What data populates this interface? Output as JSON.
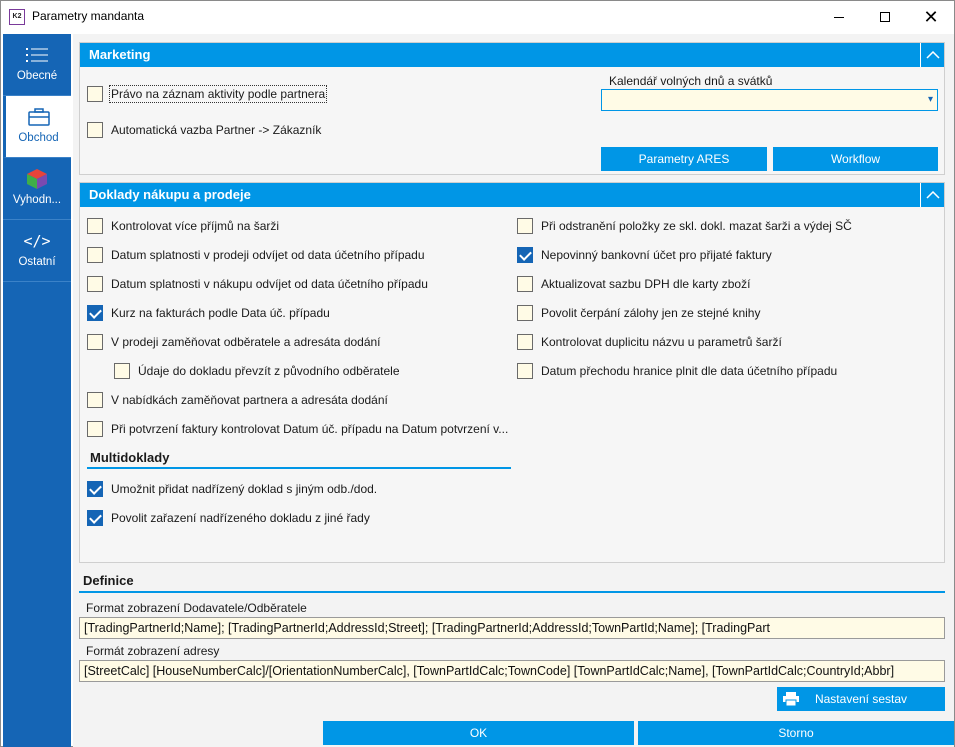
{
  "window": {
    "title": "Parametry mandanta",
    "app_icon": "K2"
  },
  "sidebar": {
    "items": [
      {
        "label": "Obecné",
        "icon": "list-icon"
      },
      {
        "label": "Obchod",
        "icon": "briefcase-icon"
      },
      {
        "label": "Vyhodn...",
        "icon": "cube-icon"
      },
      {
        "label": "Ostatní",
        "icon": "code-icon"
      }
    ],
    "active": "Obchod"
  },
  "marketing": {
    "title": "Marketing",
    "checkboxes": [
      {
        "label": "Právo na záznam aktivity podle partnera",
        "checked": false
      },
      {
        "label": "Automatická vazba Partner -> Zákazník",
        "checked": false
      }
    ],
    "calendar_label": "Kalendář volných dnů a svátků",
    "calendar_value": "",
    "ares_button": "Parametry ARES",
    "workflow_button": "Workflow"
  },
  "doklady": {
    "title": "Doklady nákupu a prodeje",
    "left": [
      {
        "label": "Kontrolovat více příjmů na šarži",
        "checked": false
      },
      {
        "label": "Datum splatnosti v prodeji odvíjet od data účetního případu",
        "checked": false
      },
      {
        "label": "Datum splatnosti v nákupu odvíjet od data účetního případu",
        "checked": false
      },
      {
        "label": "Kurz na fakturách podle Data úč. případu",
        "checked": true
      },
      {
        "label": "V prodeji zaměňovat odběratele a adresáta dodání",
        "checked": false
      },
      {
        "label": "Údaje do dokladu převzít z původního odběratele",
        "checked": false
      },
      {
        "label": "V nabídkách zaměňovat partnera a adresáta dodání",
        "checked": false
      },
      {
        "label": "Při potvrzení faktury kontrolovat Datum úč. případu na Datum potvrzení v...",
        "checked": false
      }
    ],
    "right": [
      {
        "label": "Při odstranění položky ze skl. dokl. mazat šarži a výdej SČ",
        "checked": false
      },
      {
        "label": "Nepovinný bankovní účet pro přijaté faktury",
        "checked": true
      },
      {
        "label": "Aktualizovat sazbu DPH dle karty zboží",
        "checked": false
      },
      {
        "label": "Povolit čerpání zálohy jen ze stejné knihy",
        "checked": false
      },
      {
        "label": "Kontrolovat duplicitu názvu u parametrů šarží",
        "checked": false
      },
      {
        "label": "Datum přechodu hranice plnit dle data účetního případu",
        "checked": false
      }
    ],
    "multidoklady": {
      "title": "Multidoklady",
      "items": [
        {
          "label": "Umožnit přidat nadřízený doklad s jiným odb./dod.",
          "checked": true
        },
        {
          "label": "Povolit zařazení nadřízeného dokladu z jiné řady",
          "checked": true
        }
      ]
    }
  },
  "definice": {
    "title": "Definice",
    "supplier_label": "Format zobrazení Dodavatele/Odběratele",
    "supplier_value": "[TradingPartnerId;Name]; [TradingPartnerId;AddressId;Street]; [TradingPartnerId;AddressId;TownPartId;Name]; [TradingPart",
    "address_label": "Formát zobrazení adresy",
    "address_value": "[StreetCalc] [HouseNumberCalc]/[OrientationNumberCalc], [TownPartIdCalc;TownCode]  [TownPartIdCalc;Name], [TownPartIdCalc;CountryId;Abbr]",
    "report_button": "Nastavení sestav"
  },
  "footer": {
    "ok": "OK",
    "cancel": "Storno"
  },
  "colors": {
    "accent": "#0096e6",
    "sidebar": "#1565b5",
    "field_bg": "#fffbe6"
  }
}
